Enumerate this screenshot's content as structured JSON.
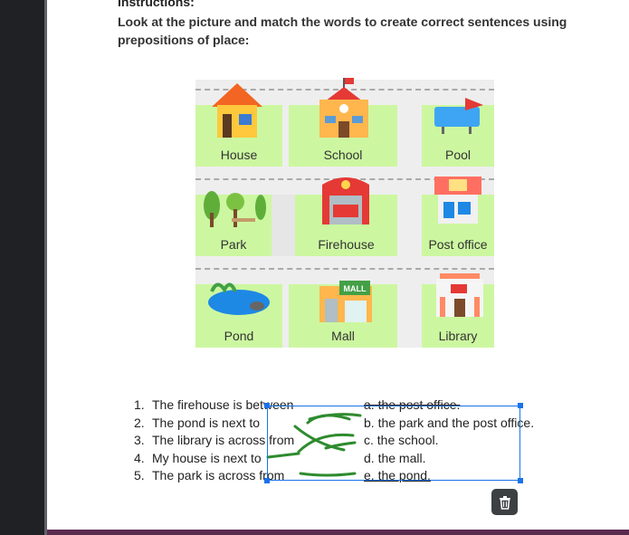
{
  "instructions": {
    "title": "Instructions:",
    "text": "Look at the picture and match the words to create correct sentences using prepositions of place:"
  },
  "map": {
    "places": [
      "House",
      "School",
      "Pool",
      "Park",
      "Firehouse",
      "Post office",
      "Pond",
      "Mall",
      "Library"
    ],
    "mall_sign": "MALL"
  },
  "sentences": [
    {
      "num": "1.",
      "text": "The firehouse is between"
    },
    {
      "num": "2.",
      "text": "The pond is next to"
    },
    {
      "num": "3.",
      "text": "The library is across from"
    },
    {
      "num": "4.",
      "text": "My house is next to"
    },
    {
      "num": "5.",
      "text": "The park is across from"
    }
  ],
  "answers": [
    {
      "text": "a. the post office."
    },
    {
      "text": "b. the park and the post office."
    },
    {
      "text": "c. the school."
    },
    {
      "text": "d. the mall."
    },
    {
      "text": "e. the pond."
    }
  ],
  "colors": {
    "tile": "#ccf7a0",
    "selection": "#1a73e8",
    "ink": "#2e8b2e"
  },
  "icons": {
    "delete": "trash-icon"
  }
}
